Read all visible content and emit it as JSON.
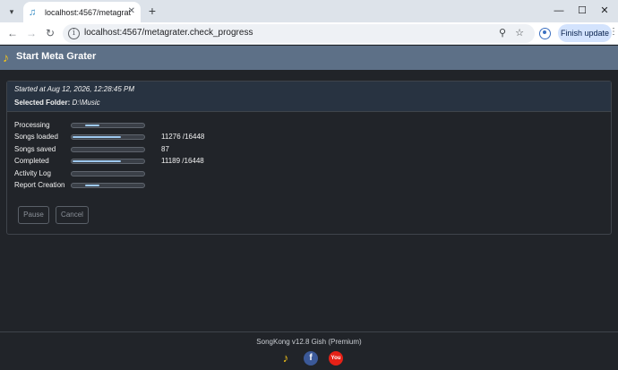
{
  "browser": {
    "tab_title": "localhost:4567/metagrater.check_progress",
    "tab_close": "✕",
    "new_tab": "+",
    "window_minimize": "—",
    "window_maximize": "☐",
    "window_close": "✕",
    "url": "localhost:4567/metagrater.check_progress",
    "finish_update_label": "Finish update",
    "icons": {
      "tab_dropdown": "chevron-down-icon",
      "favicon": "music-note-icon",
      "back": "arrow-left-icon",
      "forward": "arrow-right-icon",
      "reload": "reload-icon",
      "site_info": "site-info-icon",
      "zoom": "search-icon",
      "bookmark": "star-icon",
      "profile": "profile-icon",
      "menu": "kebab-menu-icon"
    }
  },
  "app": {
    "title": "Start Meta Grater",
    "logo_icon": "songkong-logo-icon"
  },
  "panel": {
    "started": "Started at Aug 12, 2026, 12:28:45 PM",
    "folder_label": "Selected Folder:",
    "folder_value": "D:\\Music",
    "rows": [
      {
        "label": "Processing",
        "fill_start": 0.18,
        "fill_end": 0.38,
        "value": ""
      },
      {
        "label": "Songs loaded",
        "fill_start": 0.0,
        "fill_end": 0.685,
        "value": "11276 /16448"
      },
      {
        "label": "Songs saved",
        "fill_start": 0.0,
        "fill_end": 0.0,
        "value": "87"
      },
      {
        "label": "Completed",
        "fill_start": 0.0,
        "fill_end": 0.68,
        "value": "11189 /16448"
      },
      {
        "label": "Activity Log",
        "fill_start": 0.0,
        "fill_end": 0.0,
        "value": ""
      },
      {
        "label": "Report Creation",
        "fill_start": 0.18,
        "fill_end": 0.38,
        "value": ""
      }
    ],
    "pause_label": "Pause",
    "cancel_label": "Cancel"
  },
  "footer": {
    "text": "SongKong v12.8 Gish (Premium)",
    "icons": [
      "songkong-icon",
      "facebook-icon",
      "youtube-icon"
    ]
  },
  "colors": {
    "background": "#212429",
    "header": "#5d7087",
    "panel_head": "#283341",
    "bar_fill": "#9ec9f0"
  }
}
